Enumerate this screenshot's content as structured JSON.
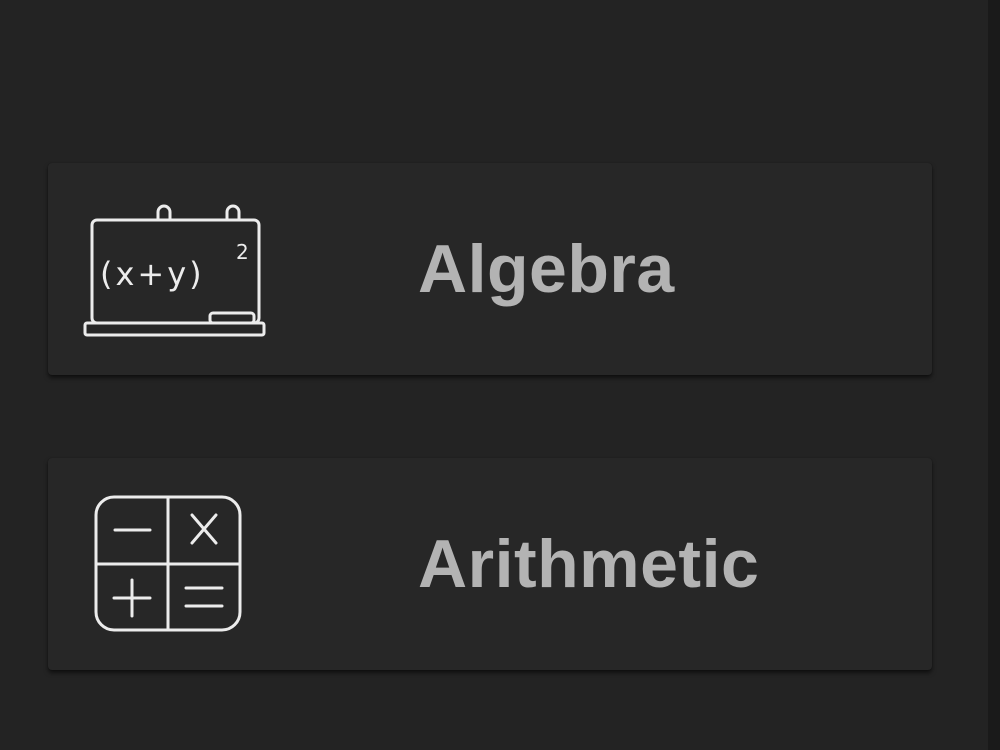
{
  "menu": {
    "items": [
      {
        "label": "Algebra",
        "icon": "chalkboard-icon",
        "icon_formula": "(x+y)",
        "icon_exponent": "2"
      },
      {
        "label": "Arithmetic",
        "icon": "calculator-operators-icon"
      }
    ]
  },
  "colors": {
    "background": "#232323",
    "card": "#272727",
    "label": "#b3b3b3",
    "icon_stroke": "#ececec"
  }
}
